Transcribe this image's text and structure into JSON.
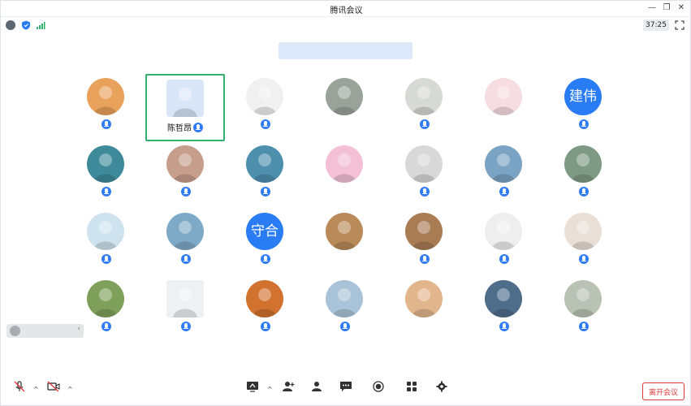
{
  "window": {
    "title": "腾讯会议",
    "minimize": "—",
    "restore": "❐",
    "close": "✕"
  },
  "status": {
    "timer": "37:25"
  },
  "speaking_banner": "",
  "participants": [
    {
      "name": "",
      "mic": true,
      "bg": "#e8a25c",
      "kind": "photo"
    },
    {
      "name": "陈哲昂",
      "mic": true,
      "bg": "#d9e6f7",
      "kind": "cartoon",
      "active": true
    },
    {
      "name": "",
      "mic": true,
      "bg": "#f0f0f0",
      "kind": "photo"
    },
    {
      "name": "",
      "mic": false,
      "bg": "#9aa39a",
      "kind": "photo"
    },
    {
      "name": "",
      "mic": true,
      "bg": "#d7d9d4",
      "kind": "photo"
    },
    {
      "name": "",
      "mic": false,
      "bg": "#f6dde2",
      "kind": "photo"
    },
    {
      "name": "",
      "mic": true,
      "bg": "#2a7cf5",
      "kind": "text",
      "text": "建伟"
    },
    {
      "name": "",
      "mic": true,
      "bg": "#3e8a9a",
      "kind": "photo"
    },
    {
      "name": "",
      "mic": true,
      "bg": "#c79e8c",
      "kind": "photo"
    },
    {
      "name": "",
      "mic": true,
      "bg": "#4e8fae",
      "kind": "photo"
    },
    {
      "name": "",
      "mic": false,
      "bg": "#f3c0d6",
      "kind": "photo"
    },
    {
      "name": "",
      "mic": true,
      "bg": "#d8d8d8",
      "kind": "photo"
    },
    {
      "name": "",
      "mic": true,
      "bg": "#7aa3c4",
      "kind": "photo"
    },
    {
      "name": "",
      "mic": true,
      "bg": "#7e9a84",
      "kind": "photo"
    },
    {
      "name": "",
      "mic": true,
      "bg": "#cfe3ef",
      "kind": "photo"
    },
    {
      "name": "",
      "mic": true,
      "bg": "#7ea9c7",
      "kind": "photo"
    },
    {
      "name": "",
      "mic": true,
      "bg": "#2a7cf5",
      "kind": "text",
      "text": "守合"
    },
    {
      "name": "",
      "mic": false,
      "bg": "#b98a5a",
      "kind": "photo"
    },
    {
      "name": "",
      "mic": true,
      "bg": "#a97c54",
      "kind": "photo"
    },
    {
      "name": "",
      "mic": true,
      "bg": "#eeeeee",
      "kind": "photo"
    },
    {
      "name": "",
      "mic": true,
      "bg": "#e9dfd7",
      "kind": "photo"
    },
    {
      "name": "",
      "mic": true,
      "bg": "#7fa05a",
      "kind": "photo"
    },
    {
      "name": "",
      "mic": true,
      "bg": "#eef1f4",
      "kind": "cartoon"
    },
    {
      "name": "",
      "mic": true,
      "bg": "#d1722f",
      "kind": "photo"
    },
    {
      "name": "",
      "mic": true,
      "bg": "#a9c4d8",
      "kind": "photo"
    },
    {
      "name": "",
      "mic": false,
      "bg": "#e2b68d",
      "kind": "photo"
    },
    {
      "name": "",
      "mic": true,
      "bg": "#4e6d8a",
      "kind": "photo"
    },
    {
      "name": "",
      "mic": true,
      "bg": "#b9c2b4",
      "kind": "photo"
    }
  ],
  "chat": {
    "placeholder": ""
  },
  "toolbar": {
    "buttons": [
      {
        "label": "",
        "icon": "mic-muted-icon"
      },
      {
        "label": "",
        "icon": "camera-off-icon"
      },
      {
        "label": "",
        "icon": "share-screen-icon"
      },
      {
        "label": "",
        "icon": "invite-icon"
      },
      {
        "label": "",
        "icon": "members-icon"
      },
      {
        "label": "",
        "icon": "chat-icon"
      },
      {
        "label": "",
        "icon": "record-icon"
      },
      {
        "label": "",
        "icon": "apps-icon"
      },
      {
        "label": "",
        "icon": "settings-icon"
      }
    ],
    "leave": "离开会议"
  },
  "colors": {
    "accent_blue": "#2a7cf5",
    "active_border": "#2fb16d",
    "leave_red": "#e23b3b",
    "banner_bg": "#dde9fb"
  }
}
